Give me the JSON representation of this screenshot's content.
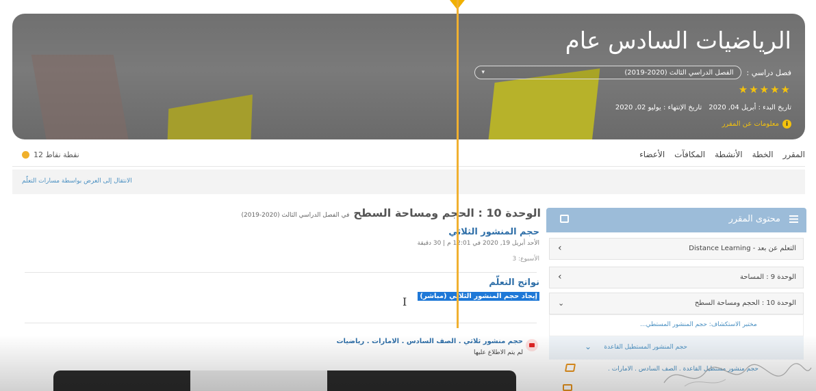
{
  "hero": {
    "title": "الرياضيات السادس عام",
    "semester_label": "فصل دراسي :",
    "semester_value": "الفصل الدراسي الثالث (2020-2019)",
    "stars": "★★★★★",
    "start_date": "تاريخ البدء : أبريل 04, 2020",
    "end_date": "تاريخ الإنتهاء : يوليو 02, 2020",
    "info_link": "معلومات عن المقرر"
  },
  "nav": {
    "tabs": [
      "المقرر",
      "الخطة",
      "الأنشطة",
      "المكافآت",
      "الأعضاء"
    ],
    "points": "12 نقطة نقاط"
  },
  "learning_path": {
    "link": "الانتقال إلى العرض بواسطة مسارات التعلّم"
  },
  "sidebar": {
    "title": "محتوى المقرر",
    "items": [
      "التعلم عن بعد - Distance Learning",
      "الوحدة 9 : المساحة",
      "الوحدة 10 : الحجم ومساحة السطح"
    ],
    "sub_items": [
      "مختبر الاستكشاف: حجم المنشور المستطي...",
      "حجم المنشور المستطيل القاعدة",
      "حجم منشور مستطيل القاعدة . الصف السادس . الامارات ."
    ]
  },
  "main": {
    "unit_title": "الوحدة 10 : الحجم ومساحة السطح",
    "unit_semester": "في الفصل الدراسي الثالث (2020-2019)",
    "lesson_title": "حجم المنشور الثلاثي",
    "lesson_date": "الأحد أبريل 19, 2020 في 12:01 م | 30 دقيقة",
    "lesson_week": "الأسبوع: 3",
    "outcomes_title": "نواتج التعلّم",
    "outcome": "إيجاد حجم المنشور الثلاثي (مباشر)",
    "video_title": "حجم منشور ثلاثي . الصف السادس . الامارات . رياضيات",
    "video_status": "لم يتم الاطلاع عليها"
  },
  "colors": {
    "accent": "#2f6fa8",
    "sidebar_header": "#9cbcd9",
    "star": "#f4c20d",
    "selection": "#1e78d7",
    "marker": "#f0b030"
  }
}
